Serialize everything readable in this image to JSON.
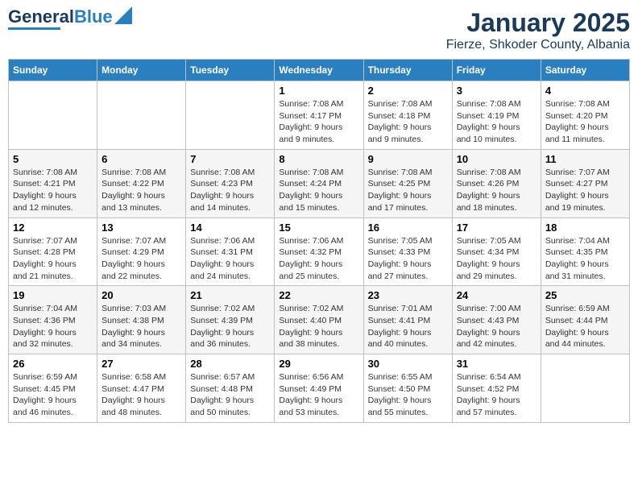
{
  "logo": {
    "line1": "General",
    "line2": "Blue"
  },
  "title": "January 2025",
  "subtitle": "Fierze, Shkoder County, Albania",
  "days_of_week": [
    "Sunday",
    "Monday",
    "Tuesday",
    "Wednesday",
    "Thursday",
    "Friday",
    "Saturday"
  ],
  "weeks": [
    [
      {
        "day": "",
        "info": ""
      },
      {
        "day": "",
        "info": ""
      },
      {
        "day": "",
        "info": ""
      },
      {
        "day": "1",
        "info": "Sunrise: 7:08 AM\nSunset: 4:17 PM\nDaylight: 9 hours\nand 9 minutes."
      },
      {
        "day": "2",
        "info": "Sunrise: 7:08 AM\nSunset: 4:18 PM\nDaylight: 9 hours\nand 9 minutes."
      },
      {
        "day": "3",
        "info": "Sunrise: 7:08 AM\nSunset: 4:19 PM\nDaylight: 9 hours\nand 10 minutes."
      },
      {
        "day": "4",
        "info": "Sunrise: 7:08 AM\nSunset: 4:20 PM\nDaylight: 9 hours\nand 11 minutes."
      }
    ],
    [
      {
        "day": "5",
        "info": "Sunrise: 7:08 AM\nSunset: 4:21 PM\nDaylight: 9 hours\nand 12 minutes."
      },
      {
        "day": "6",
        "info": "Sunrise: 7:08 AM\nSunset: 4:22 PM\nDaylight: 9 hours\nand 13 minutes."
      },
      {
        "day": "7",
        "info": "Sunrise: 7:08 AM\nSunset: 4:23 PM\nDaylight: 9 hours\nand 14 minutes."
      },
      {
        "day": "8",
        "info": "Sunrise: 7:08 AM\nSunset: 4:24 PM\nDaylight: 9 hours\nand 15 minutes."
      },
      {
        "day": "9",
        "info": "Sunrise: 7:08 AM\nSunset: 4:25 PM\nDaylight: 9 hours\nand 17 minutes."
      },
      {
        "day": "10",
        "info": "Sunrise: 7:08 AM\nSunset: 4:26 PM\nDaylight: 9 hours\nand 18 minutes."
      },
      {
        "day": "11",
        "info": "Sunrise: 7:07 AM\nSunset: 4:27 PM\nDaylight: 9 hours\nand 19 minutes."
      }
    ],
    [
      {
        "day": "12",
        "info": "Sunrise: 7:07 AM\nSunset: 4:28 PM\nDaylight: 9 hours\nand 21 minutes."
      },
      {
        "day": "13",
        "info": "Sunrise: 7:07 AM\nSunset: 4:29 PM\nDaylight: 9 hours\nand 22 minutes."
      },
      {
        "day": "14",
        "info": "Sunrise: 7:06 AM\nSunset: 4:31 PM\nDaylight: 9 hours\nand 24 minutes."
      },
      {
        "day": "15",
        "info": "Sunrise: 7:06 AM\nSunset: 4:32 PM\nDaylight: 9 hours\nand 25 minutes."
      },
      {
        "day": "16",
        "info": "Sunrise: 7:05 AM\nSunset: 4:33 PM\nDaylight: 9 hours\nand 27 minutes."
      },
      {
        "day": "17",
        "info": "Sunrise: 7:05 AM\nSunset: 4:34 PM\nDaylight: 9 hours\nand 29 minutes."
      },
      {
        "day": "18",
        "info": "Sunrise: 7:04 AM\nSunset: 4:35 PM\nDaylight: 9 hours\nand 31 minutes."
      }
    ],
    [
      {
        "day": "19",
        "info": "Sunrise: 7:04 AM\nSunset: 4:36 PM\nDaylight: 9 hours\nand 32 minutes."
      },
      {
        "day": "20",
        "info": "Sunrise: 7:03 AM\nSunset: 4:38 PM\nDaylight: 9 hours\nand 34 minutes."
      },
      {
        "day": "21",
        "info": "Sunrise: 7:02 AM\nSunset: 4:39 PM\nDaylight: 9 hours\nand 36 minutes."
      },
      {
        "day": "22",
        "info": "Sunrise: 7:02 AM\nSunset: 4:40 PM\nDaylight: 9 hours\nand 38 minutes."
      },
      {
        "day": "23",
        "info": "Sunrise: 7:01 AM\nSunset: 4:41 PM\nDaylight: 9 hours\nand 40 minutes."
      },
      {
        "day": "24",
        "info": "Sunrise: 7:00 AM\nSunset: 4:43 PM\nDaylight: 9 hours\nand 42 minutes."
      },
      {
        "day": "25",
        "info": "Sunrise: 6:59 AM\nSunset: 4:44 PM\nDaylight: 9 hours\nand 44 minutes."
      }
    ],
    [
      {
        "day": "26",
        "info": "Sunrise: 6:59 AM\nSunset: 4:45 PM\nDaylight: 9 hours\nand 46 minutes."
      },
      {
        "day": "27",
        "info": "Sunrise: 6:58 AM\nSunset: 4:47 PM\nDaylight: 9 hours\nand 48 minutes."
      },
      {
        "day": "28",
        "info": "Sunrise: 6:57 AM\nSunset: 4:48 PM\nDaylight: 9 hours\nand 50 minutes."
      },
      {
        "day": "29",
        "info": "Sunrise: 6:56 AM\nSunset: 4:49 PM\nDaylight: 9 hours\nand 53 minutes."
      },
      {
        "day": "30",
        "info": "Sunrise: 6:55 AM\nSunset: 4:50 PM\nDaylight: 9 hours\nand 55 minutes."
      },
      {
        "day": "31",
        "info": "Sunrise: 6:54 AM\nSunset: 4:52 PM\nDaylight: 9 hours\nand 57 minutes."
      },
      {
        "day": "",
        "info": ""
      }
    ]
  ]
}
